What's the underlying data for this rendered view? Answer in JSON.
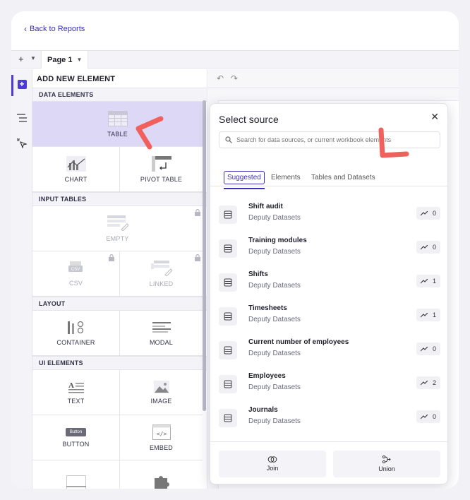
{
  "header": {
    "back_label": "Back to Reports"
  },
  "pagebar": {
    "add": "+",
    "page_tab": "Page 1"
  },
  "panel": {
    "title": "ADD NEW ELEMENT",
    "sections": {
      "data": "DATA ELEMENTS",
      "input": "INPUT TABLES",
      "layout": "LAYOUT",
      "ui": "UI ELEMENTS"
    },
    "tiles": {
      "table": "TABLE",
      "chart": "CHART",
      "pivot": "PIVOT TABLE",
      "empty": "EMPTY",
      "csv": "CSV",
      "linked": "LINKED",
      "container": "CONTAINER",
      "modal": "MODAL",
      "text": "TEXT",
      "image": "IMAGE",
      "button": "BUTTON",
      "button_glyph": "Button",
      "embed": "EMBED"
    }
  },
  "modal": {
    "title": "Select source",
    "search_placeholder": "Search for data sources, or current workbook elements",
    "tabs": [
      "Suggested",
      "Elements",
      "Tables and Datasets"
    ],
    "items": [
      {
        "name": "Shift audit",
        "source": "Deputy Datasets",
        "count": "0"
      },
      {
        "name": "Training modules",
        "source": "Deputy Datasets",
        "count": "0"
      },
      {
        "name": "Shifts",
        "source": "Deputy Datasets",
        "count": "1"
      },
      {
        "name": "Timesheets",
        "source": "Deputy Datasets",
        "count": "1"
      },
      {
        "name": "Current number of employees",
        "source": "Deputy Datasets",
        "count": "0"
      },
      {
        "name": "Employees",
        "source": "Deputy Datasets",
        "count": "2"
      },
      {
        "name": "Journals",
        "source": "Deputy Datasets",
        "count": "0"
      }
    ],
    "join_label": "Join",
    "union_label": "Union"
  },
  "colors": {
    "accent": "#3c2fb8",
    "selected_tile": "#ddd8f6",
    "annotation": "#f0605d"
  }
}
